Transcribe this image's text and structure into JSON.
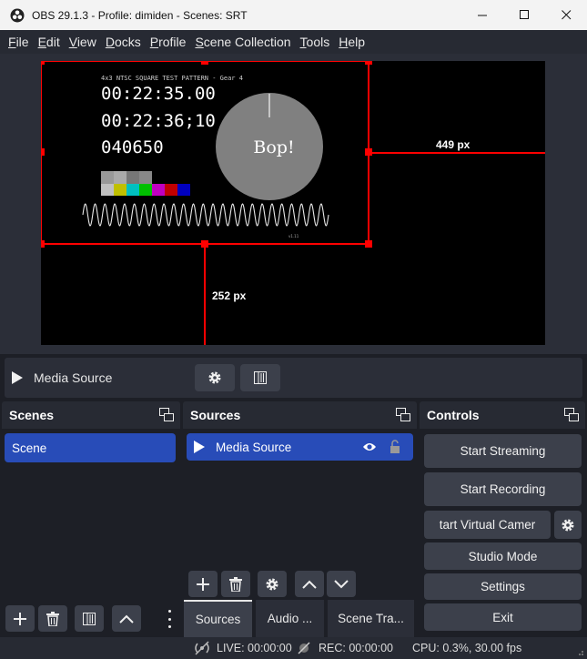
{
  "window": {
    "title": "OBS 29.1.3 - Profile: dimiden - Scenes: SRT"
  },
  "menu": [
    {
      "pre": "",
      "ul": "F",
      "post": "ile"
    },
    {
      "pre": "",
      "ul": "E",
      "post": "dit"
    },
    {
      "pre": "",
      "ul": "V",
      "post": "iew"
    },
    {
      "pre": "",
      "ul": "D",
      "post": "ocks"
    },
    {
      "pre": "",
      "ul": "P",
      "post": "rofile"
    },
    {
      "pre": "",
      "ul": "S",
      "post": "cene Collection"
    },
    {
      "pre": "",
      "ul": "T",
      "post": "ools"
    },
    {
      "pre": "",
      "ul": "H",
      "post": "elp"
    }
  ],
  "preview": {
    "pattern_title": "4x3 NTSC SQUARE TEST PATTERN - Gear 4",
    "time1": "00:22:35.00",
    "time2": "00:22:36;10",
    "frame": "040650",
    "bop": "Bop!",
    "version": "v1.11",
    "distance_right": "449 px",
    "distance_bottom": "252 px",
    "color_bars": [
      "#c0c0c0",
      "#c0c000",
      "#00c0c0",
      "#00c000",
      "#c000c0",
      "#c00000",
      "#0000c0"
    ]
  },
  "source_toolbar": {
    "source_name": "Media Source"
  },
  "scenes": {
    "header": "Scenes",
    "items": [
      "Scene"
    ]
  },
  "sources": {
    "header": "Sources",
    "items": [
      "Media Source"
    ]
  },
  "controls": {
    "header": "Controls",
    "start_streaming": "Start Streaming",
    "start_recording": "Start Recording",
    "virtual_camera": "tart Virtual Camer",
    "studio_mode": "Studio Mode",
    "settings": "Settings",
    "exit": "Exit"
  },
  "tabs": {
    "sources": "Sources",
    "audio": "Audio ...",
    "transitions": "Scene Tra..."
  },
  "status": {
    "live": "LIVE: 00:00:00",
    "rec": "REC: 00:00:00",
    "cpu": "CPU: 0.3%, 30.00 fps"
  },
  "colors": {
    "selection": "#284cb8",
    "bounding_box": "#ff0000"
  }
}
